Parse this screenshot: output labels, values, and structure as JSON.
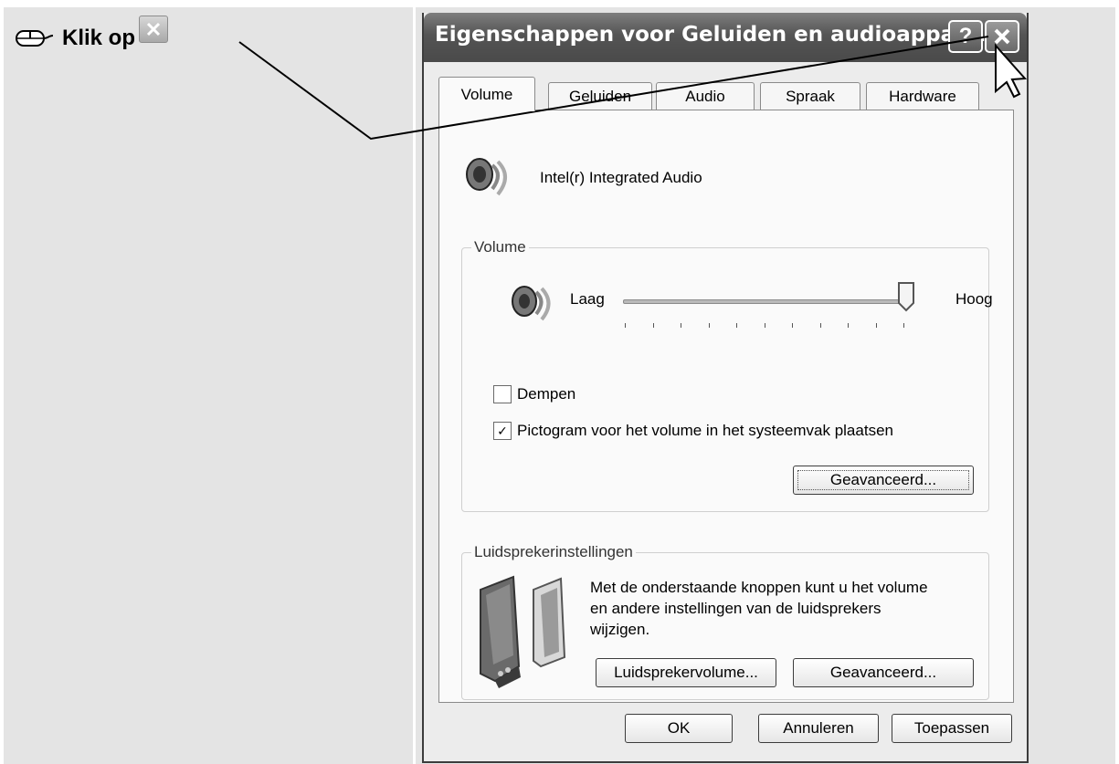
{
  "instruction": {
    "text": "Klik op"
  },
  "dialog": {
    "title": "Eigenschappen voor Geluiden en audioappar...",
    "help_glyph": "?",
    "close_glyph": "✕",
    "tabs": [
      {
        "label": "Volume",
        "active": true
      },
      {
        "label": "Geluiden",
        "active": false
      },
      {
        "label": "Audio",
        "active": false
      },
      {
        "label": "Spraak",
        "active": false
      },
      {
        "label": "Hardware",
        "active": false
      }
    ],
    "device_name": "Intel(r) Integrated Audio",
    "volume_group": {
      "title": "Volume",
      "low_label": "Laag",
      "high_label": "Hoog",
      "level": 1.0,
      "mute": {
        "label": "Dempen",
        "checked": false
      },
      "tray_icon": {
        "label": "Pictogram voor het volume in het systeemvak plaatsen",
        "checked": true
      },
      "advanced_button": "Geavanceerd..."
    },
    "speaker_group": {
      "title": "Luidsprekerinstellingen",
      "description": "Met de onderstaande knoppen kunt u het volume en andere instellingen van de luidsprekers wijzigen.",
      "volume_button": "Luidsprekervolume...",
      "advanced_button": "Geavanceerd..."
    },
    "buttons": {
      "ok": "OK",
      "cancel": "Annuleren",
      "apply": "Toepassen"
    }
  }
}
